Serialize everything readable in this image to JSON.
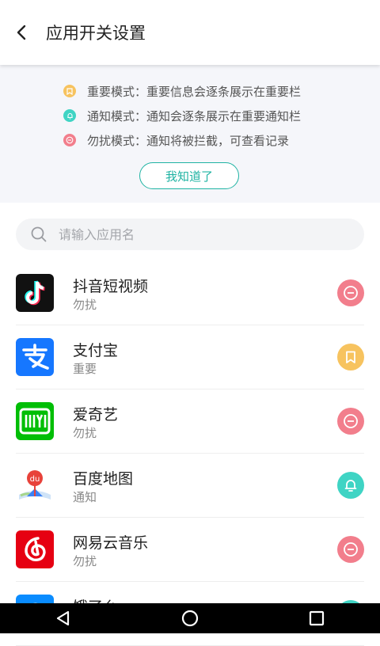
{
  "header": {
    "title": "应用开关设置"
  },
  "info": {
    "modes": [
      {
        "text": "重要模式：重要信息会逐条展示在重要栏",
        "color": "#f7c35f"
      },
      {
        "text": "通知模式：通知会逐条展示在重要通知栏",
        "color": "#3fd4c4"
      },
      {
        "text": "勿扰模式：通知将被拦截，可查看记录",
        "color": "#f27e8c"
      }
    ],
    "ok_label": "我知道了"
  },
  "search": {
    "placeholder": "请输入应用名",
    "value": ""
  },
  "apps": [
    {
      "name": "抖音短视频",
      "mode": "勿扰",
      "icon": "douyin-icon",
      "mode_icon": "minus-circle-icon",
      "btn_color": "#f27e8c"
    },
    {
      "name": "支付宝",
      "mode": "重要",
      "icon": "alipay-icon",
      "mode_icon": "bookmark-icon",
      "btn_color": "#f7c35f"
    },
    {
      "name": "爱奇艺",
      "mode": "勿扰",
      "icon": "iqiyi-icon",
      "mode_icon": "minus-circle-icon",
      "btn_color": "#f27e8c"
    },
    {
      "name": "百度地图",
      "mode": "通知",
      "icon": "baidu-map-icon",
      "mode_icon": "bell-icon",
      "btn_color": "#3fd4c4"
    },
    {
      "name": "网易云音乐",
      "mode": "勿扰",
      "icon": "netease-music-icon",
      "mode_icon": "minus-circle-icon",
      "btn_color": "#f27e8c"
    },
    {
      "name": "饿了么",
      "mode": "",
      "icon": "eleme-icon",
      "mode_icon": "bell-icon",
      "btn_color": "#3fd4c4"
    }
  ],
  "colors": {
    "accent": "#1fb3a3",
    "important": "#f7c35f",
    "notify": "#3fd4c4",
    "dnd": "#f27e8c"
  }
}
